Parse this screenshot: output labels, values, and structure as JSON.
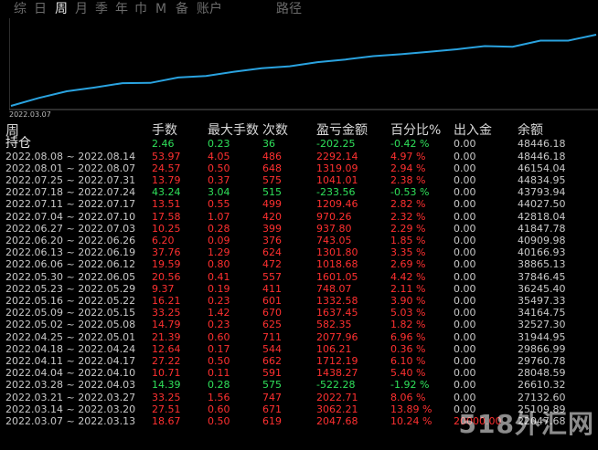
{
  "tabs": [
    {
      "label": "综",
      "active": false
    },
    {
      "label": "日",
      "active": false
    },
    {
      "label": "周",
      "active": true
    },
    {
      "label": "月",
      "active": false
    },
    {
      "label": "季",
      "active": false
    },
    {
      "label": "年",
      "active": false
    },
    {
      "label": "巾",
      "active": false
    },
    {
      "label": "M",
      "active": false
    },
    {
      "label": "备",
      "active": false
    },
    {
      "label": "账户",
      "active": false
    },
    {
      "label": "路径",
      "active": false
    }
  ],
  "chart": {
    "date_label": "2022.03.07",
    "line_color": "#2aa3e0",
    "balances": [
      20976.89,
      24047.6,
      26610.32,
      28048.59,
      29760.78,
      29866.99,
      31944.95,
      32527.3,
      34164.75,
      35497.33,
      36245.4,
      37846.45,
      38865.13,
      40166.93,
      40909.98,
      41847.78,
      42818.04,
      44027.5,
      43793.94,
      46154.04,
      46154.04,
      48446.18
    ]
  },
  "table": {
    "headers": [
      "周",
      "手数",
      "最大手数",
      "次数",
      "盈亏金额",
      "百分比%",
      "出入金",
      "余额"
    ],
    "holding": {
      "label": "持仓",
      "lots": "2.46",
      "max_lots": "0.23",
      "count": "36",
      "pnl": "-202.25",
      "percent": "-0.42 %",
      "inout": "0.00",
      "balance": "48446.18",
      "sign": "pos"
    },
    "rows": [
      {
        "period": "2022.08.08 ~ 2022.08.14",
        "lots": "53.97",
        "max_lots": "4.05",
        "count": "486",
        "pnl": "2292.14",
        "percent": "4.97 %",
        "inout": "0.00",
        "balance": "48446.18",
        "sign": "neg"
      },
      {
        "period": "2022.08.01 ~ 2022.08.07",
        "lots": "24.57",
        "max_lots": "0.50",
        "count": "648",
        "pnl": "1319.09",
        "percent": "2.94 %",
        "inout": "0.00",
        "balance": "46154.04",
        "sign": "neg"
      },
      {
        "period": "2022.07.25 ~ 2022.07.31",
        "lots": "13.79",
        "max_lots": "0.37",
        "count": "575",
        "pnl": "1041.01",
        "percent": "2.38 %",
        "inout": "0.00",
        "balance": "44834.95",
        "sign": "neg"
      },
      {
        "period": "2022.07.18 ~ 2022.07.24",
        "lots": "43.24",
        "max_lots": "3.04",
        "count": "515",
        "pnl": "-233.56",
        "percent": "-0.53 %",
        "inout": "0.00",
        "balance": "43793.94",
        "sign": "pos"
      },
      {
        "period": "2022.07.11 ~ 2022.07.17",
        "lots": "13.51",
        "max_lots": "0.55",
        "count": "499",
        "pnl": "1209.46",
        "percent": "2.82 %",
        "inout": "0.00",
        "balance": "44027.50",
        "sign": "neg"
      },
      {
        "period": "2022.07.04 ~ 2022.07.10",
        "lots": "17.58",
        "max_lots": "1.07",
        "count": "420",
        "pnl": "970.26",
        "percent": "2.32 %",
        "inout": "0.00",
        "balance": "42818.04",
        "sign": "neg"
      },
      {
        "period": "2022.06.27 ~ 2022.07.03",
        "lots": "10.25",
        "max_lots": "0.28",
        "count": "399",
        "pnl": "937.80",
        "percent": "2.29 %",
        "inout": "0.00",
        "balance": "41847.78",
        "sign": "neg"
      },
      {
        "period": "2022.06.20 ~ 2022.06.26",
        "lots": "6.20",
        "max_lots": "0.09",
        "count": "376",
        "pnl": "743.05",
        "percent": "1.85 %",
        "inout": "0.00",
        "balance": "40909.98",
        "sign": "neg"
      },
      {
        "period": "2022.06.13 ~ 2022.06.19",
        "lots": "37.76",
        "max_lots": "1.29",
        "count": "624",
        "pnl": "1301.80",
        "percent": "3.35 %",
        "inout": "0.00",
        "balance": "40166.93",
        "sign": "neg"
      },
      {
        "period": "2022.06.06 ~ 2022.06.12",
        "lots": "19.59",
        "max_lots": "0.80",
        "count": "472",
        "pnl": "1018.68",
        "percent": "2.69 %",
        "inout": "0.00",
        "balance": "38865.13",
        "sign": "neg"
      },
      {
        "period": "2022.05.30 ~ 2022.06.05",
        "lots": "20.56",
        "max_lots": "0.41",
        "count": "557",
        "pnl": "1601.05",
        "percent": "4.42 %",
        "inout": "0.00",
        "balance": "37846.45",
        "sign": "neg"
      },
      {
        "period": "2022.05.23 ~ 2022.05.29",
        "lots": "9.37",
        "max_lots": "0.19",
        "count": "411",
        "pnl": "748.07",
        "percent": "2.11 %",
        "inout": "0.00",
        "balance": "36245.40",
        "sign": "neg"
      },
      {
        "period": "2022.05.16 ~ 2022.05.22",
        "lots": "16.21",
        "max_lots": "0.23",
        "count": "601",
        "pnl": "1332.58",
        "percent": "3.90 %",
        "inout": "0.00",
        "balance": "35497.33",
        "sign": "neg"
      },
      {
        "period": "2022.05.09 ~ 2022.05.15",
        "lots": "33.25",
        "max_lots": "1.42",
        "count": "670",
        "pnl": "1637.45",
        "percent": "5.03 %",
        "inout": "0.00",
        "balance": "34164.75",
        "sign": "neg"
      },
      {
        "period": "2022.05.02 ~ 2022.05.08",
        "lots": "14.79",
        "max_lots": "0.23",
        "count": "625",
        "pnl": "582.35",
        "percent": "1.82 %",
        "inout": "0.00",
        "balance": "32527.30",
        "sign": "neg"
      },
      {
        "period": "2022.04.25 ~ 2022.05.01",
        "lots": "21.39",
        "max_lots": "0.60",
        "count": "711",
        "pnl": "2077.96",
        "percent": "6.96 %",
        "inout": "0.00",
        "balance": "31944.95",
        "sign": "neg"
      },
      {
        "period": "2022.04.18 ~ 2022.04.24",
        "lots": "12.64",
        "max_lots": "0.17",
        "count": "544",
        "pnl": "106.21",
        "percent": "0.36 %",
        "inout": "0.00",
        "balance": "29866.99",
        "sign": "neg"
      },
      {
        "period": "2022.04.11 ~ 2022.04.17",
        "lots": "27.22",
        "max_lots": "0.50",
        "count": "662",
        "pnl": "1712.19",
        "percent": "6.10 %",
        "inout": "0.00",
        "balance": "29760.78",
        "sign": "neg"
      },
      {
        "period": "2022.04.04 ~ 2022.04.10",
        "lots": "10.71",
        "max_lots": "0.11",
        "count": "591",
        "pnl": "1438.27",
        "percent": "5.40 %",
        "inout": "0.00",
        "balance": "28048.59",
        "sign": "neg"
      },
      {
        "period": "2022.03.28 ~ 2022.04.03",
        "lots": "14.39",
        "max_lots": "0.28",
        "count": "575",
        "pnl": "-522.28",
        "percent": "-1.92 %",
        "inout": "0.00",
        "balance": "26610.32",
        "sign": "pos"
      },
      {
        "period": "2022.03.21 ~ 2022.03.27",
        "lots": "33.25",
        "max_lots": "1.56",
        "count": "747",
        "pnl": "2022.71",
        "percent": "8.06 %",
        "inout": "0.00",
        "balance": "27132.60",
        "sign": "neg"
      },
      {
        "period": "2022.03.14 ~ 2022.03.20",
        "lots": "27.51",
        "max_lots": "0.60",
        "count": "671",
        "pnl": "3062.21",
        "percent": "13.89 %",
        "inout": "0.00",
        "balance": "25109.89",
        "sign": "neg"
      },
      {
        "period": "2022.03.07 ~ 2022.03.13",
        "lots": "18.67",
        "max_lots": "0.50",
        "count": "619",
        "pnl": "2047.68",
        "percent": "10.24 %",
        "inout": "20000.00",
        "balance": "22047.68",
        "sign": "neg"
      }
    ]
  },
  "watermark": "518外汇网"
}
